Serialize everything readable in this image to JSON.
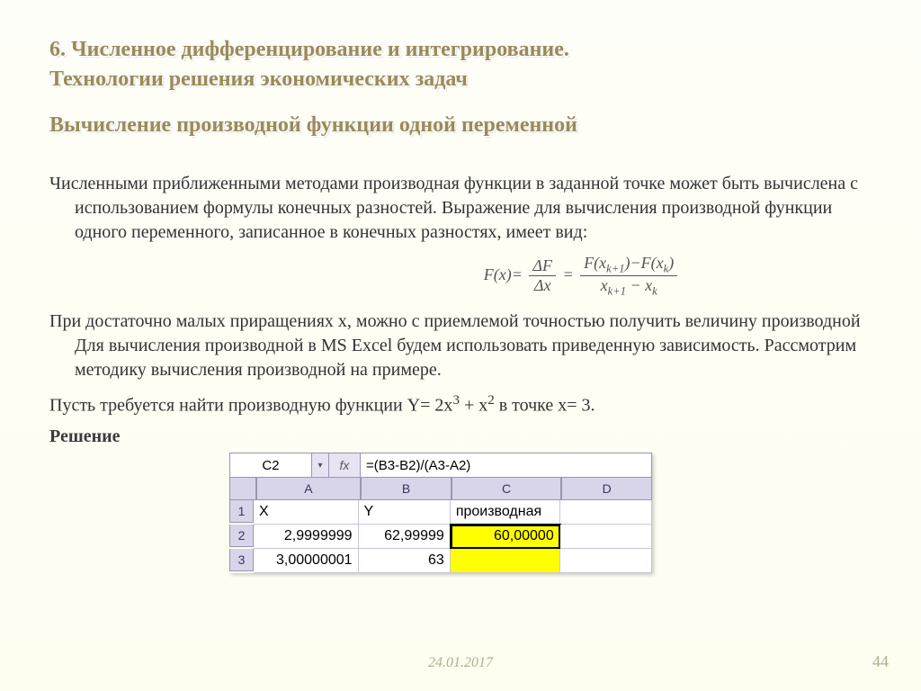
{
  "title": {
    "line1": "6. Численное дифференцирование и интегрирование.",
    "line2": "Технологии решения экономических задач",
    "subtitle": "Вычисление производной функции одной переменной"
  },
  "paragraphs": {
    "p1": "Численными приближенными методами производная функции в заданной точке может быть вычислена с использованием формулы конечных разностей. Выражение для вычисления производной функции одного переменного, записанное в конечных разностях, имеет вид:",
    "p2": "При достаточно малых  приращениях x, можно с приемлемой точностью получить величину производной Для вычисления производной в MS Excel будем использовать приведенную зависимость. Рассмотрим методику вычисления производной на примере.",
    "p3_prefix": "Пусть требуется найти производную функции Y= 2x",
    "p3_mid": " + x",
    "p3_suffix": " в точке x= 3.",
    "solution_label": "Решение"
  },
  "formula": {
    "lead": "F(x)=",
    "num1": "ΔF",
    "den1": "Δx",
    "eq": "=",
    "num2a": "F(x",
    "num2b": ")−F(x",
    "num2c": ")",
    "den2a": "x",
    "den2b": " − x",
    "sub_kp1": "k+1",
    "sub_k": "k"
  },
  "excel": {
    "namebox": "C2",
    "fx_label": "fx",
    "formula": "=(B3-B2)/(A3-A2)",
    "headers": {
      "A": "A",
      "B": "B",
      "C": "C",
      "D": "D"
    },
    "rows": {
      "r1": {
        "n": "1",
        "A": "X",
        "B": "Y",
        "C": "производная",
        "D": ""
      },
      "r2": {
        "n": "2",
        "A": "2,9999999",
        "B": "62,99999",
        "C": "60,00000",
        "D": ""
      },
      "r3": {
        "n": "3",
        "A": "3,00000001",
        "B": "63",
        "C": "",
        "D": ""
      }
    }
  },
  "footer": {
    "date": "24.01.2017",
    "page": "44"
  }
}
